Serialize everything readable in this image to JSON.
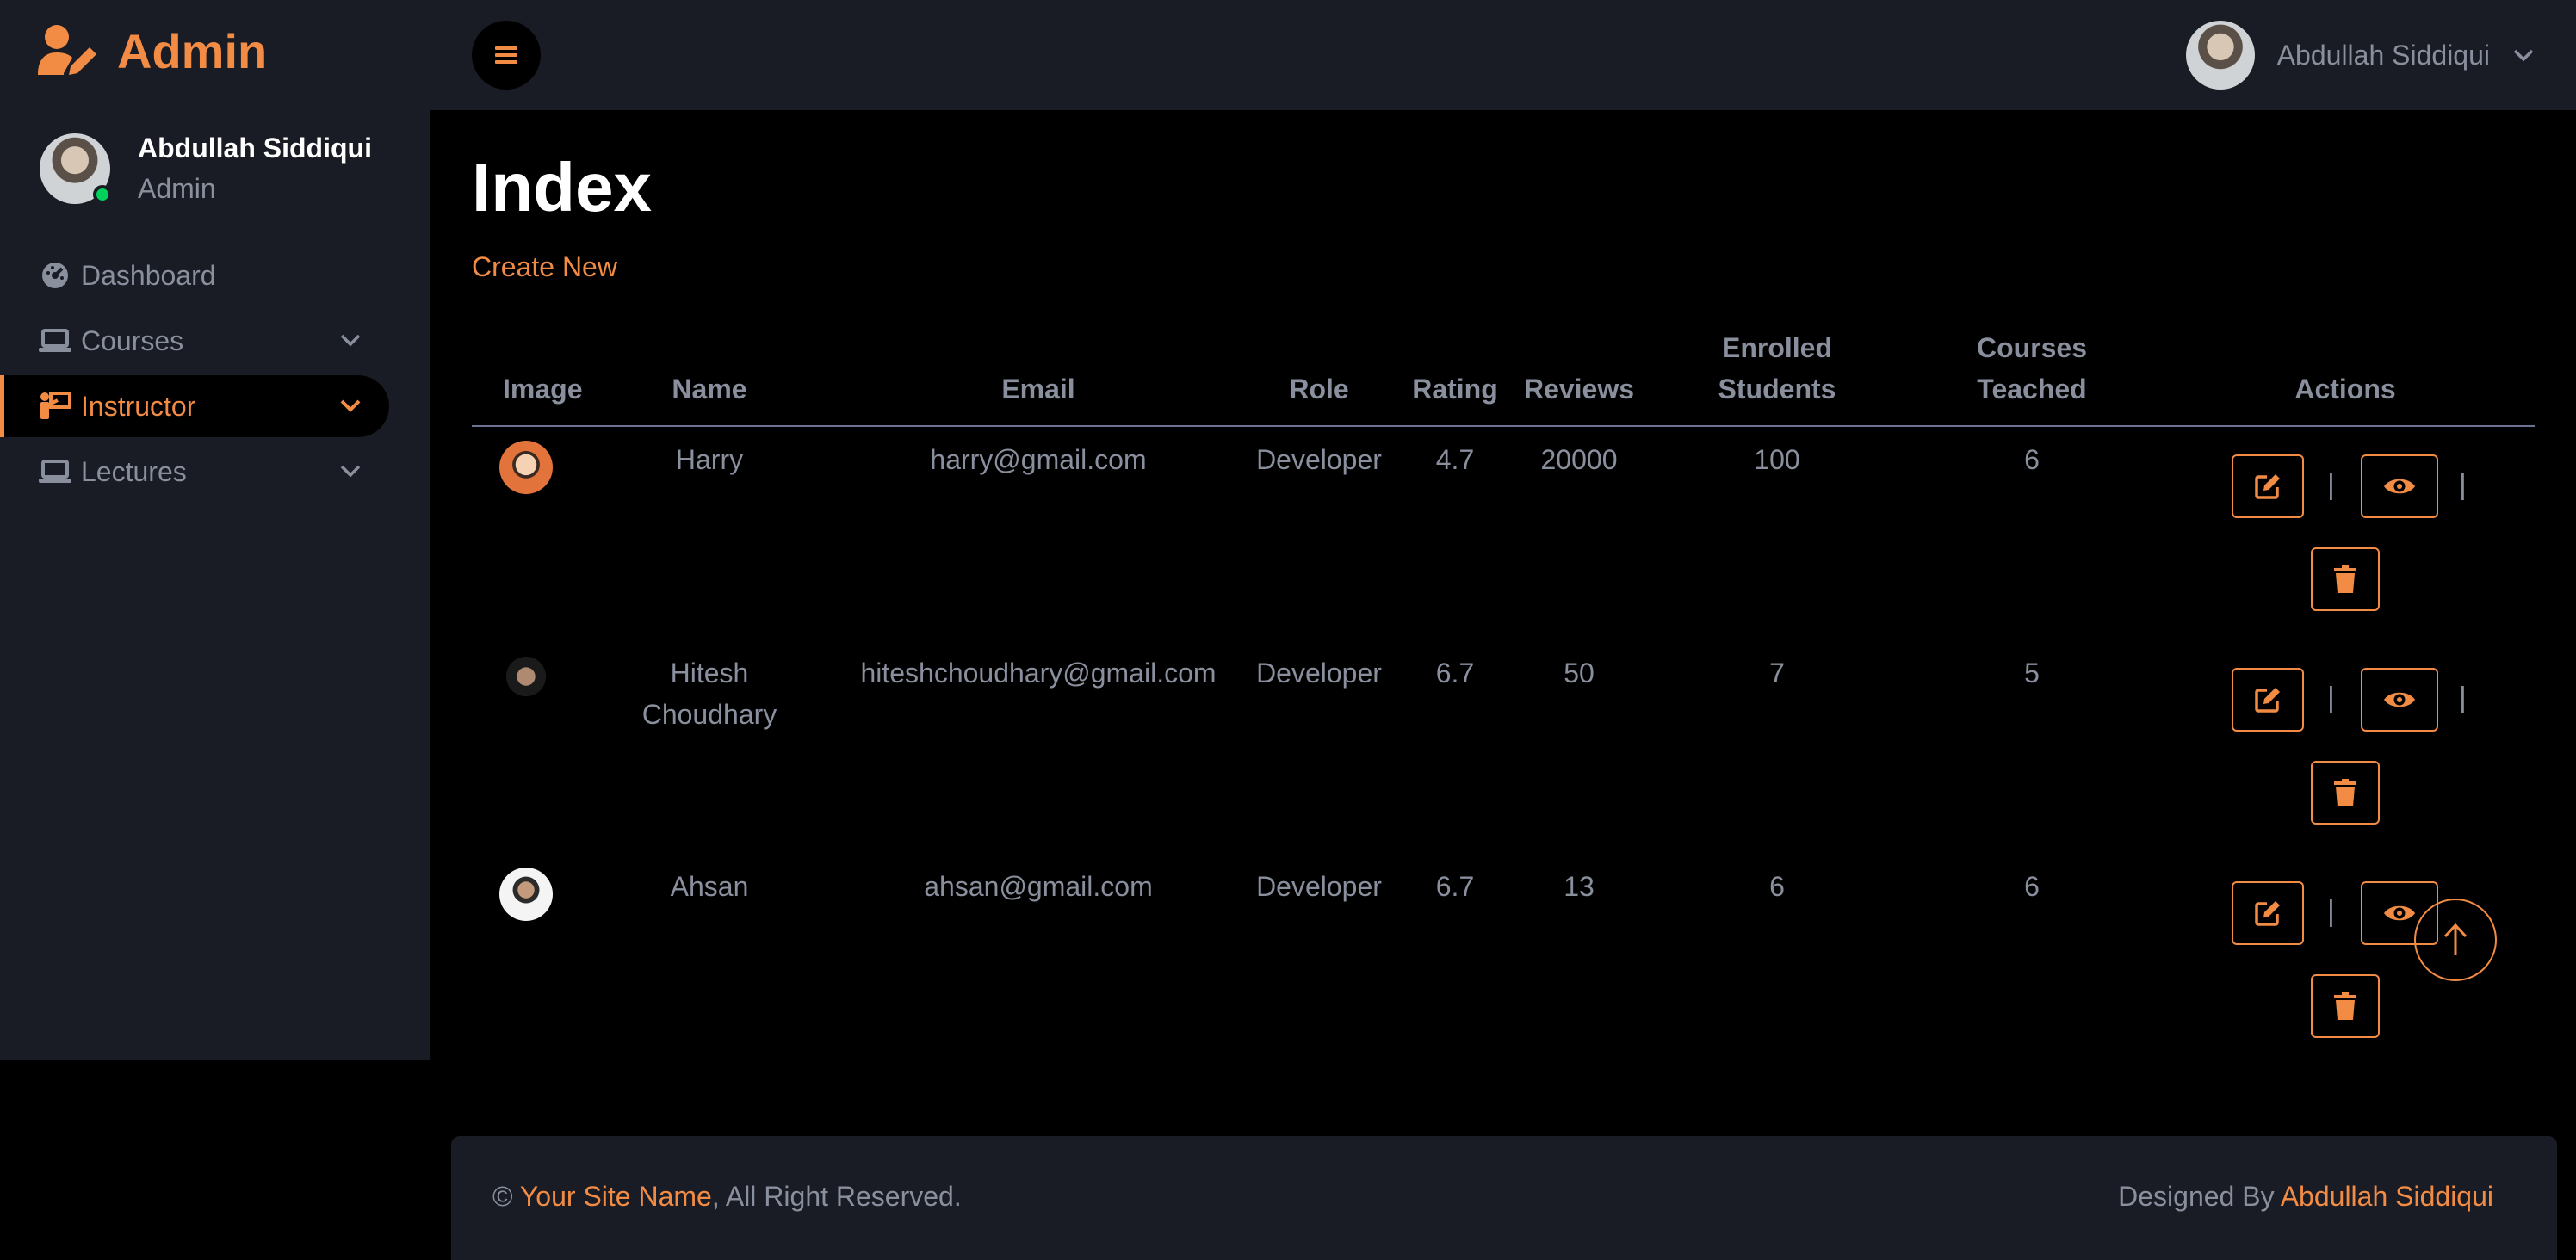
{
  "brand": {
    "title": "Admin"
  },
  "sidebar": {
    "profile": {
      "name": "Abdullah Siddiqui",
      "role": "Admin"
    },
    "items": [
      {
        "label": "Dashboard",
        "icon": "dashboard-icon"
      },
      {
        "label": "Courses",
        "icon": "laptop-icon"
      },
      {
        "label": "Instructor",
        "icon": "instructor-icon",
        "active": true
      },
      {
        "label": "Lectures",
        "icon": "laptop-icon"
      }
    ]
  },
  "topbar": {
    "user_name": "Abdullah Siddiqui"
  },
  "main": {
    "title": "Index",
    "create_new": "Create New",
    "columns": {
      "image": "Image",
      "name": "Name",
      "email": "Email",
      "role": "Role",
      "rating": "Rating",
      "reviews": "Reviews",
      "enrolled_1": "Enrolled",
      "enrolled_2": "Students",
      "courses_1": "Courses",
      "courses_2": "Teached",
      "actions": "Actions"
    },
    "rows": [
      {
        "name": "Harry",
        "name_2": "",
        "email": "harry@gmail.com",
        "role": "Developer",
        "rating": "4.7",
        "reviews": "20000",
        "enrolled": "100",
        "courses": "6"
      },
      {
        "name": "Hitesh",
        "name_2": "Choudhary",
        "email": "hiteshchoudhary@gmail.com",
        "role": "Developer",
        "rating": "6.7",
        "reviews": "50",
        "enrolled": "7",
        "courses": "5"
      },
      {
        "name": "Ahsan",
        "name_2": "",
        "email": "ahsan@gmail.com",
        "role": "Developer",
        "rating": "6.7",
        "reviews": "13",
        "enrolled": "6",
        "courses": "6"
      }
    ],
    "separator": "|"
  },
  "footer": {
    "copyright_symbol": "©",
    "site_name": "Your Site Name",
    "rights": ", All Right Reserved.",
    "designed_by": "Designed By",
    "designer": "Abdullah Siddiqui"
  },
  "colors": {
    "accent": "#f28c45",
    "sidebar_bg": "#191c24",
    "page_bg": "#000000",
    "muted_text": "#8a8f9e",
    "online": "#00d25b"
  }
}
